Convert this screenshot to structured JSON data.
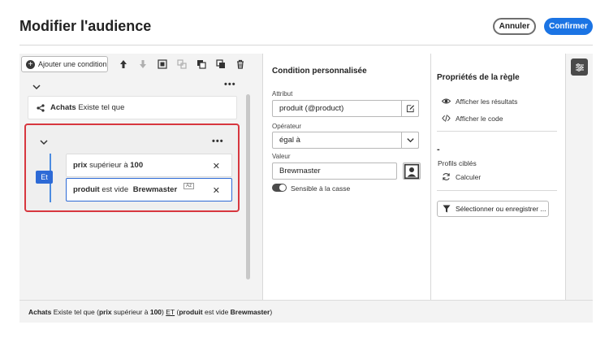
{
  "header": {
    "title": "Modifier l'audience",
    "cancel_label": "Annuler",
    "confirm_label": "Confirmer"
  },
  "toolbar": {
    "add_condition_label": "Ajouter une condition",
    "tools": [
      {
        "name": "move-up-icon",
        "enabled": true
      },
      {
        "name": "move-down-icon",
        "enabled": false
      },
      {
        "name": "group-icon",
        "enabled": true
      },
      {
        "name": "ungroup-icon",
        "enabled": false
      },
      {
        "name": "copy-icon",
        "enabled": true
      },
      {
        "name": "paste-icon",
        "enabled": true
      },
      {
        "name": "delete-icon",
        "enabled": true
      }
    ]
  },
  "tree": {
    "root_menu": "•••",
    "achats": {
      "entity": "Achats",
      "operator": "Existe tel que"
    },
    "group": {
      "menu": "•••",
      "connector": "Et",
      "conditions": [
        {
          "field": "prix",
          "operator": "supérieur à",
          "value": "100",
          "badge": ""
        },
        {
          "field": "produit",
          "operator": "est vide",
          "value": "Brewmaster",
          "badge": "Az"
        }
      ]
    }
  },
  "custom_condition": {
    "title": "Condition personnalisée",
    "attribute_label": "Attribut",
    "attribute_value": "produit (@product)",
    "operator_label": "Opérateur",
    "operator_value": "égal à",
    "value_label": "Valeur",
    "value_value": "Brewmaster",
    "case_sensitive_label": "Sensible à la casse"
  },
  "rule_properties": {
    "title": "Propriétés de la règle",
    "show_results": "Afficher les résultats",
    "show_code": "Afficher le code",
    "profiles_count": "-",
    "profiles_label": "Profils ciblés",
    "calculate": "Calculer",
    "select_or_save": "Sélectionner ou enregistrer ..."
  },
  "summary": {
    "entity": "Achats",
    "exists": "Existe tel que",
    "open": "(",
    "f1": "prix",
    "op1": "supérieur à",
    "v1": "100",
    "close1": ")",
    "conj": "ET",
    "open2": "(",
    "f2": "produit",
    "op2": "est vide",
    "v2": "Brewmaster",
    "close2": ")"
  }
}
